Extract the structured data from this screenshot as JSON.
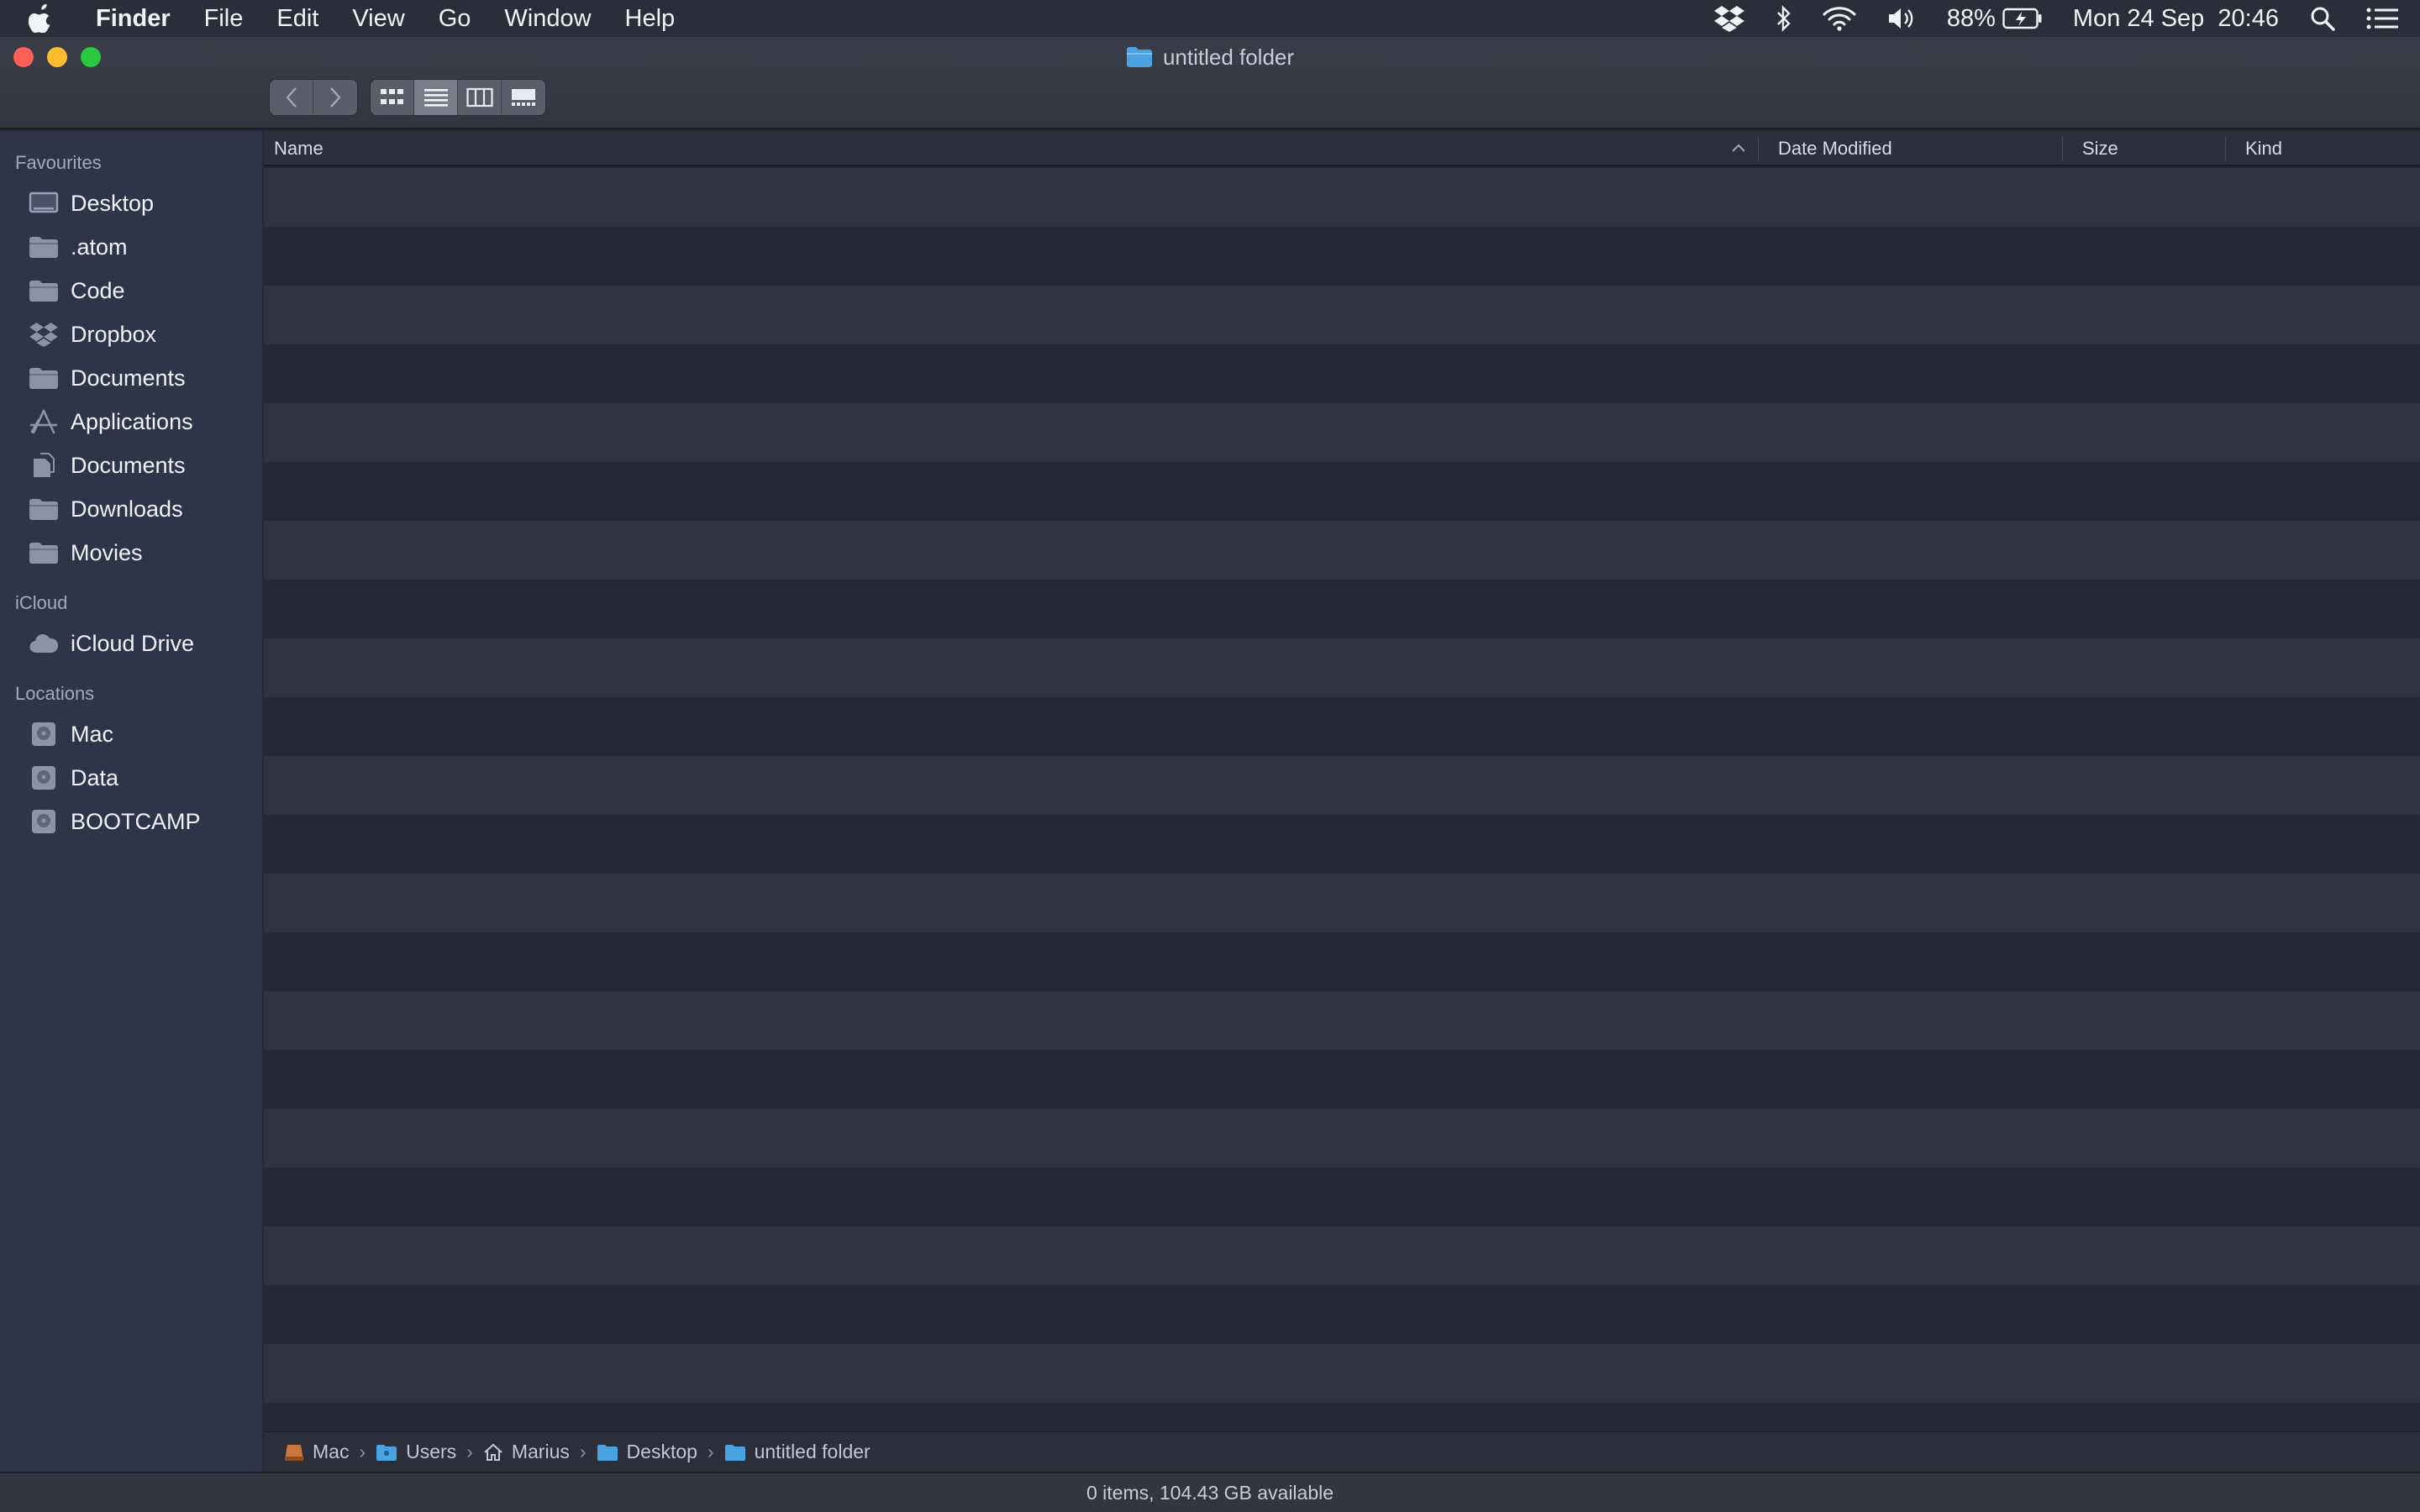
{
  "menubar": {
    "app": "Finder",
    "items": [
      "File",
      "Edit",
      "View",
      "Go",
      "Window",
      "Help"
    ],
    "battery": "88%",
    "datetime": "Mon 24 Sep  20:46"
  },
  "window": {
    "title": "untitled folder",
    "view_mode": "list"
  },
  "sidebar": {
    "favourites_label": "Favourites",
    "favourites": [
      {
        "label": "Desktop",
        "icon": "desktop-icon"
      },
      {
        "label": ".atom",
        "icon": "folder-icon"
      },
      {
        "label": "Code",
        "icon": "folder-icon"
      },
      {
        "label": "Dropbox",
        "icon": "dropbox-icon"
      },
      {
        "label": "Documents",
        "icon": "folder-icon"
      },
      {
        "label": "Applications",
        "icon": "applications-icon"
      },
      {
        "label": "Documents",
        "icon": "document-icon"
      },
      {
        "label": "Downloads",
        "icon": "folder-icon"
      },
      {
        "label": "Movies",
        "icon": "folder-icon"
      }
    ],
    "icloud_label": "iCloud",
    "icloud": [
      {
        "label": "iCloud Drive",
        "icon": "cloud-icon"
      }
    ],
    "locations_label": "Locations",
    "locations": [
      {
        "label": "Mac",
        "icon": "disk-icon"
      },
      {
        "label": "Data",
        "icon": "disk-icon"
      },
      {
        "label": "BOOTCAMP",
        "icon": "disk-icon"
      }
    ]
  },
  "columns": {
    "name": "Name",
    "date_modified": "Date Modified",
    "size": "Size",
    "kind": "Kind"
  },
  "pathbar": [
    {
      "label": "Mac",
      "icon": "disk-icon"
    },
    {
      "label": "Users",
      "icon": "folder-icon"
    },
    {
      "label": "Marius",
      "icon": "home-icon"
    },
    {
      "label": "Desktop",
      "icon": "folder-icon"
    },
    {
      "label": "untitled folder",
      "icon": "folder-icon"
    }
  ],
  "status": "0 items, 104.43 GB available",
  "colors": {
    "accent_folder": "#4aa3e0",
    "close": "#fe5f57",
    "minimize": "#febc2e",
    "zoom": "#28c840"
  }
}
